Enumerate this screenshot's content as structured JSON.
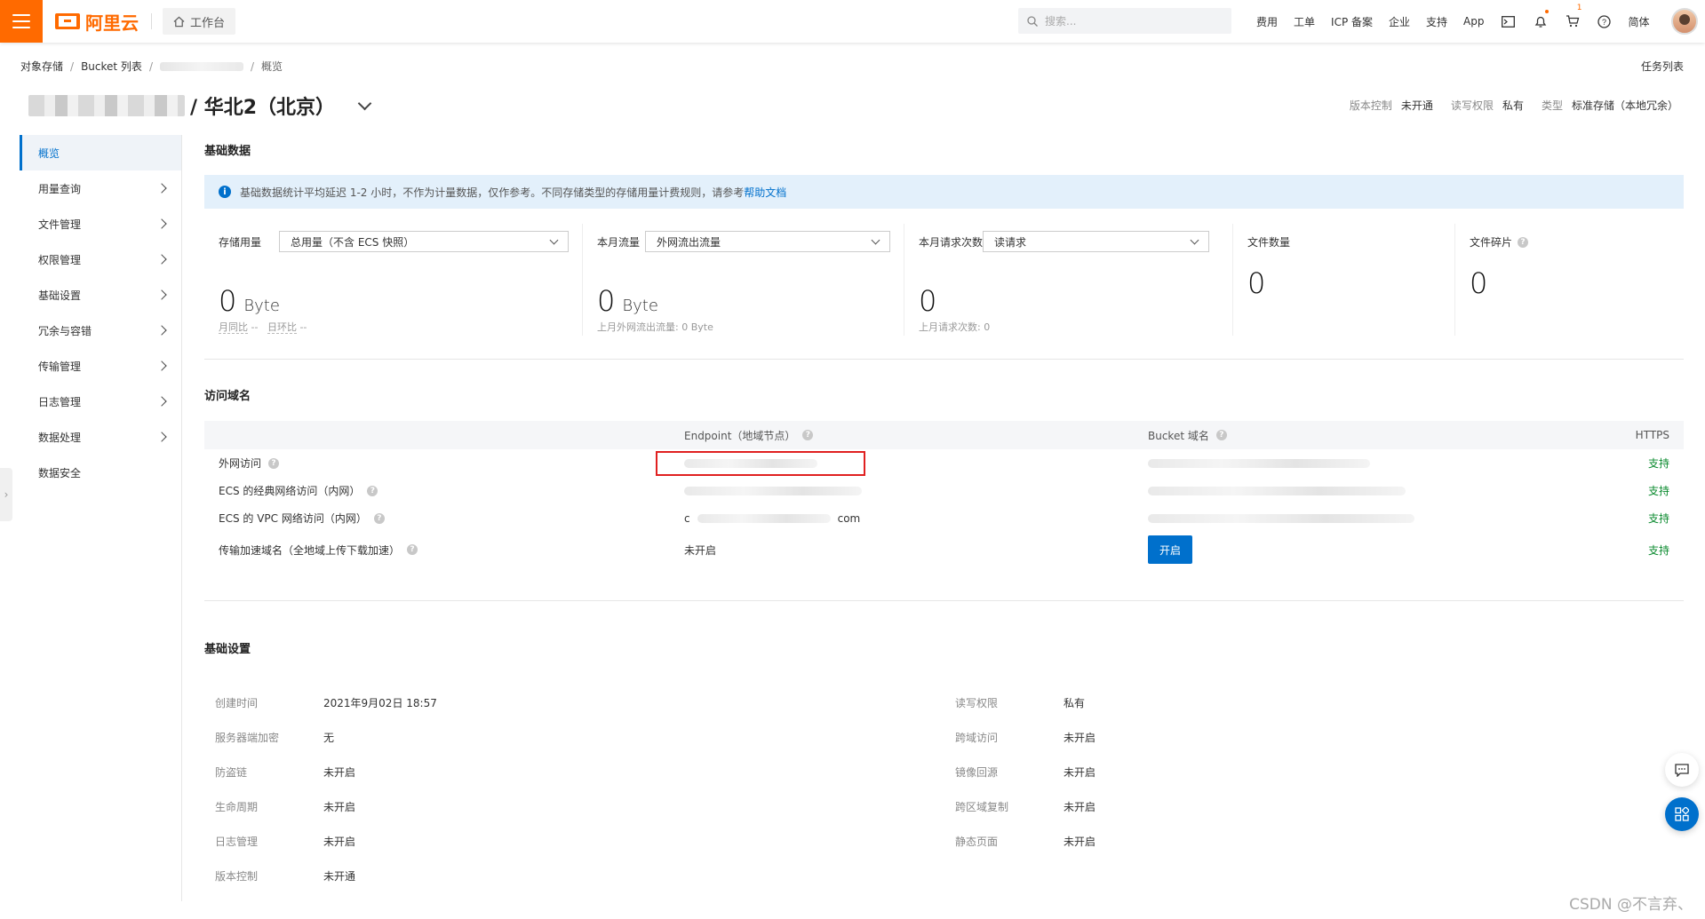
{
  "topbar": {
    "brand": "阿里云",
    "workbench": "工作台",
    "search_placeholder": "搜索...",
    "links": [
      "费用",
      "工单",
      "ICP 备案",
      "企业",
      "支持",
      "App"
    ],
    "lang": "简体",
    "cart_badge": "1",
    "accent_color": "#ff6a00"
  },
  "breadcrumb": {
    "items": [
      "对象存储",
      "Bucket 列表",
      "概览"
    ],
    "task_list": "任务列表"
  },
  "header": {
    "title": "/ 华北2（北京）",
    "props": [
      {
        "k": "版本控制",
        "v": "未开通"
      },
      {
        "k": "读写权限",
        "v": "私有"
      },
      {
        "k": "类型",
        "v": "标准存储（本地冗余）"
      }
    ]
  },
  "sidebar": {
    "items": [
      {
        "label": "概览",
        "active": true,
        "expand": false
      },
      {
        "label": "用量查询",
        "expand": true
      },
      {
        "label": "文件管理",
        "expand": true
      },
      {
        "label": "权限管理",
        "expand": true
      },
      {
        "label": "基础设置",
        "expand": true
      },
      {
        "label": "冗余与容错",
        "expand": true
      },
      {
        "label": "传输管理",
        "expand": true
      },
      {
        "label": "日志管理",
        "expand": true
      },
      {
        "label": "数据处理",
        "expand": true
      },
      {
        "label": "数据安全",
        "expand": false
      }
    ]
  },
  "basic_data": {
    "title": "基础数据",
    "notice": "基础数据统计平均延迟 1-2 小时，不作为计量数据，仅作参考。不同存储类型的存储用量计费规则，请参考",
    "notice_link": "帮助文档",
    "stats": [
      {
        "label": "存储用量",
        "select": "总用量（不含 ECS 快照）",
        "value": "0",
        "unit": "Byte",
        "sub_a": "月同比",
        "sub_a_v": "--",
        "sub_b": "日环比",
        "sub_b_v": "--"
      },
      {
        "label": "本月流量",
        "select": "外网流出流量",
        "value": "0",
        "unit": "Byte",
        "sub": "上月外网流出流量:  0 Byte"
      },
      {
        "label": "本月请求次数",
        "select": "读请求",
        "value": "0",
        "sub": "上月请求次数:    0"
      },
      {
        "label": "文件数量",
        "value": "0"
      },
      {
        "label": "文件碎片",
        "value": "0"
      }
    ]
  },
  "access": {
    "title": "访问域名",
    "headers": {
      "endpoint": "Endpoint（地域节点）",
      "bucket": "Bucket 域名",
      "https": "HTTPS"
    },
    "rows": [
      {
        "name": "外网访问",
        "endpoint": "",
        "bucket": "",
        "https": "支持"
      },
      {
        "name": "ECS 的经典网络访问（内网）",
        "endpoint": "",
        "bucket": "",
        "https": "支持"
      },
      {
        "name": "ECS 的 VPC 网络访问（内网）",
        "endpoint_tail": "com",
        "endpoint_head": "c",
        "bucket": "",
        "https": "支持"
      },
      {
        "name": "传输加速域名（全地域上传下载加速）",
        "endpoint": "未开启",
        "button": "开启",
        "https": "支持"
      }
    ]
  },
  "settings": {
    "title": "基础设置",
    "left": [
      {
        "k": "创建时间",
        "v": "2021年9月02日 18:57"
      },
      {
        "k": "服务器端加密",
        "v": "无"
      },
      {
        "k": "防盗链",
        "v": "未开启"
      },
      {
        "k": "生命周期",
        "v": "未开启"
      },
      {
        "k": "日志管理",
        "v": "未开启"
      },
      {
        "k": "版本控制",
        "v": "未开通"
      }
    ],
    "right": [
      {
        "k": "读写权限",
        "v": "私有"
      },
      {
        "k": "跨域访问",
        "v": "未开启"
      },
      {
        "k": "镜像回源",
        "v": "未开启"
      },
      {
        "k": "跨区域复制",
        "v": "未开启"
      },
      {
        "k": "静态页面",
        "v": "未开启"
      }
    ]
  },
  "watermark": "CSDN @不言弃、"
}
